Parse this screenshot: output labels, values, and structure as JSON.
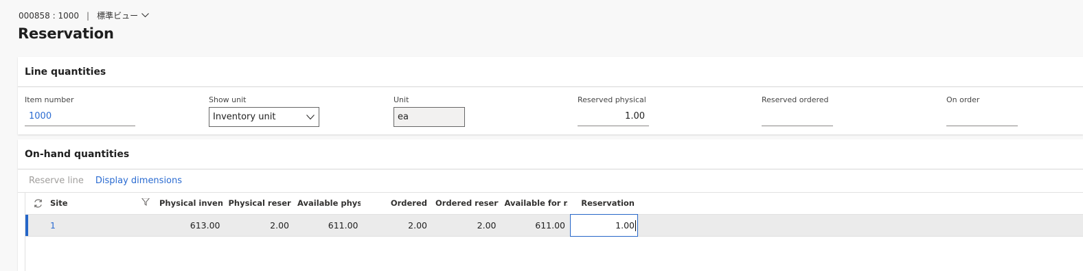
{
  "header": {
    "record_id": "000858 : 1000",
    "separator": "|",
    "view_name": "標準ビュー",
    "title": "Reservation"
  },
  "line_quantities": {
    "section_title": "Line quantities",
    "fields": {
      "item_number": {
        "label": "Item number",
        "value": "1000"
      },
      "show_unit": {
        "label": "Show unit",
        "value": "Inventory unit"
      },
      "unit": {
        "label": "Unit",
        "value": "ea"
      },
      "reserved_physical": {
        "label": "Reserved physical",
        "value": "1.00"
      },
      "reserved_ordered": {
        "label": "Reserved ordered",
        "value": ""
      },
      "on_order": {
        "label": "On order",
        "value": ""
      }
    }
  },
  "on_hand": {
    "section_title": "On-hand quantities",
    "actions": {
      "reserve_line": "Reserve line",
      "display_dimensions": "Display dimensions"
    },
    "columns": {
      "site": "Site",
      "physical_inventory": "Physical invent...",
      "physical_reserved": "Physical reserv...",
      "available_physical": "Available physi...",
      "ordered": "Ordered",
      "ordered_reserved": "Ordered reserv...",
      "available_for_reservation": "Available for r...",
      "reservation": "Reservation"
    },
    "rows": [
      {
        "site": "1",
        "physical_inventory": "613.00",
        "physical_reserved": "2.00",
        "available_physical": "611.00",
        "ordered": "2.00",
        "ordered_reserved": "2.00",
        "available_for_reservation": "611.00",
        "reservation": "1.00"
      }
    ]
  },
  "icons": [
    "chevron-down-icon",
    "refresh-icon",
    "filter-icon"
  ],
  "colors": {
    "accent": "#2566c8",
    "link": "#2a6bd1",
    "disabled": "#a19f9d"
  }
}
